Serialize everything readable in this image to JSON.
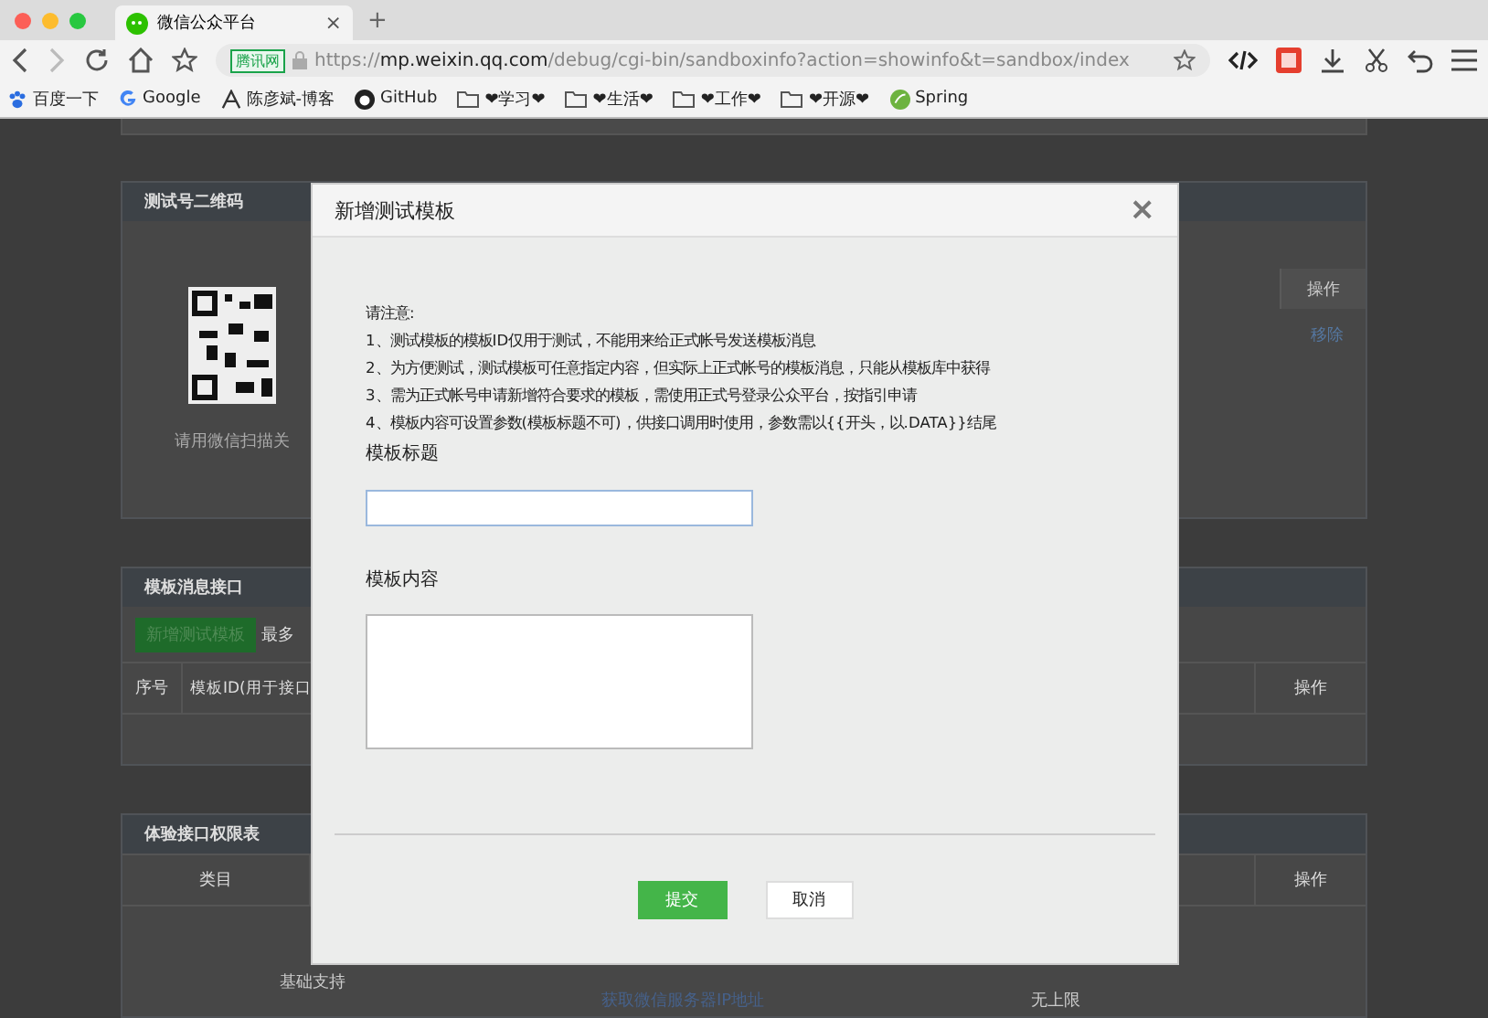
{
  "browser": {
    "tab": {
      "title": "微信公众平台",
      "close": "×"
    },
    "new_tab": "+",
    "address": {
      "badge": "腾讯网",
      "scheme": "https://",
      "host": "mp.weixin.qq.com",
      "path": "/debug/cgi-bin/sandboxinfo?action=showinfo&t=sandbox/index"
    },
    "bookmarks": [
      {
        "label": "百度一下",
        "kind": "paw"
      },
      {
        "label": "Google",
        "kind": "google"
      },
      {
        "label": "陈彦斌-博客",
        "kind": "mark"
      },
      {
        "label": "GitHub",
        "kind": "github"
      },
      {
        "label": "❤学习❤",
        "kind": "folder"
      },
      {
        "label": "❤生活❤",
        "kind": "folder"
      },
      {
        "label": "❤工作❤",
        "kind": "folder"
      },
      {
        "label": "❤开源❤",
        "kind": "folder"
      },
      {
        "label": "Spring",
        "kind": "spring"
      }
    ]
  },
  "qr_panel": {
    "title": "测试号二维码",
    "caption": "请用微信扫描关",
    "column": "操作",
    "action": "移除"
  },
  "template_panel": {
    "title": "模板消息接口",
    "add_button": "新增测试模板",
    "note": "最多",
    "columns": [
      "序号",
      "模板ID(用于接口",
      "操作"
    ]
  },
  "api_panel": {
    "title": "体验接口权限表",
    "columns": [
      "类目",
      "操作"
    ],
    "group": "基础支持",
    "link": "获取微信服务器IP地址",
    "limit": "无上限"
  },
  "dialog": {
    "title": "新增测试模板",
    "close": "×",
    "notice_title": "请注意:",
    "notices": [
      "1、测试模板的模板ID仅用于测试，不能用来给正式帐号发送模板消息",
      "2、为方便测试，测试模板可任意指定内容，但实际上正式帐号的模板消息，只能从模板库中获得",
      "3、需为正式帐号申请新增符合要求的模板，需使用正式号登录公众平台，按指引申请",
      "4、模板内容可设置参数(模板标题不可)，供接口调用时使用，参数需以{{开头，以.DATA}}结尾"
    ],
    "title_label": "模板标题",
    "content_label": "模板内容",
    "submit": "提交",
    "cancel": "取消"
  }
}
